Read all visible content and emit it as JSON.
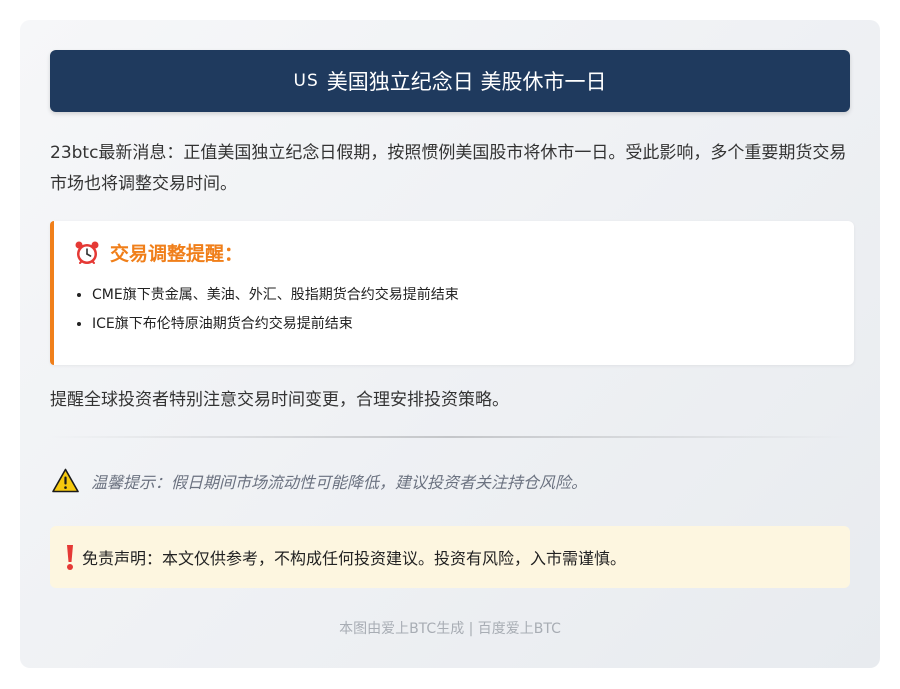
{
  "header": {
    "flag": "US",
    "title": "美国独立纪念日 美股休市一日"
  },
  "intro": {
    "text": "23btc最新消息：正值美国独立纪念日假期，按照惯例美国股市将休市一日。受此影响，多个重要期货交易市场也将调整交易时间。"
  },
  "notice": {
    "icon": "alarm-clock-icon",
    "title": "交易调整提醒：",
    "items": [
      "CME旗下贵金属、美油、外汇、股指期货合约交易提前结束",
      "ICE旗下布伦特原油期货合约交易提前结束"
    ],
    "accent_color": "#f07f1a"
  },
  "reminder": {
    "text": "提醒全球投资者特别注意交易时间变更，合理安排投资策略。"
  },
  "tip": {
    "icon": "warning-icon",
    "text": "温馨提示：假日期间市场流动性可能降低，建议投资者关注持仓风险。"
  },
  "disclaimer": {
    "icon": "exclamation-icon",
    "text": "免责声明：本文仅供参考，不构成任何投资建议。投资有风险，入市需谨慎。"
  },
  "footer": {
    "text": "本图由爱上BTC生成 | 百度爱上BTC"
  },
  "colors": {
    "header_bg": "#1f3a5e",
    "accent": "#f07f1a",
    "disclaimer_bg": "#fdf6e0"
  }
}
